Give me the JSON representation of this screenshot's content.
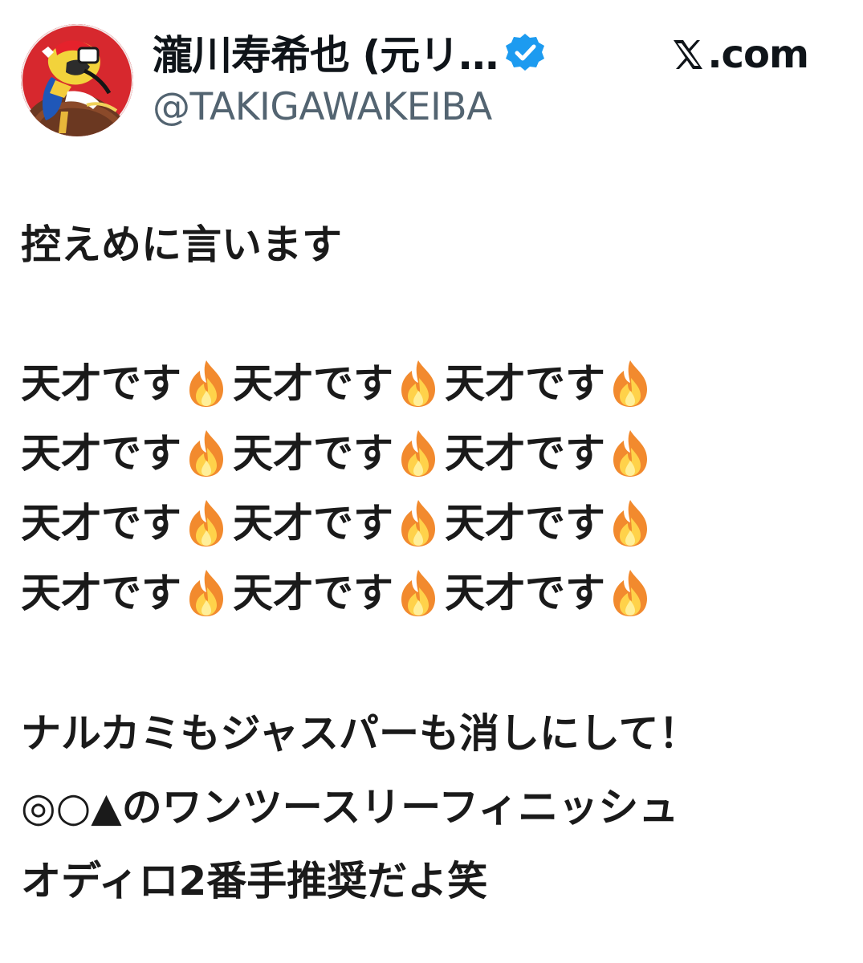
{
  "header": {
    "display_name": "瀧川寿希也 (元リ…",
    "handle": "@TAKIGAWAKEIBA",
    "site_label": ".com",
    "avatar_icon": "jockey-avatar-icon",
    "verified_icon": "verified-badge-icon",
    "brand_icon": "x-logo-icon"
  },
  "tweet": {
    "intro": "控えめに言います",
    "genius_text": "天才です",
    "fire_icon": "fire-emoji-icon",
    "genius_rows": [
      [
        "天才です",
        "天才です",
        "天才です"
      ],
      [
        "天才です",
        "天才です",
        "天才です"
      ],
      [
        "天才です",
        "天才です",
        "天才です"
      ],
      [
        "天才です",
        "天才です",
        "天才です"
      ]
    ],
    "line1": "ナルカミもジャスパーも消しにして！",
    "line2": "◎○▲のワンツースリーフィニッシュ",
    "line3": "オディロ2番手推奨だよ笑"
  },
  "colors": {
    "text": "#0f1419",
    "handle": "#536471",
    "verified": "#1d9bf0",
    "avatar_background": "#c81e24"
  }
}
